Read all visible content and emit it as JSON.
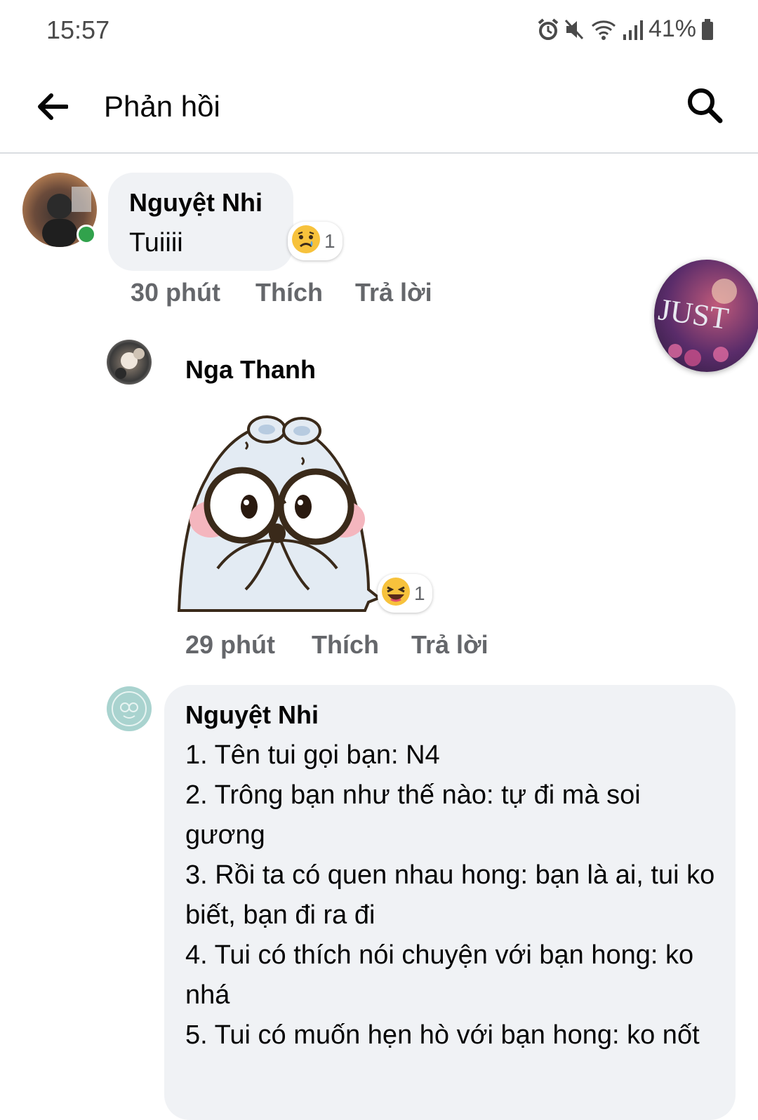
{
  "status_bar": {
    "time": "15:57",
    "battery": "41%"
  },
  "header": {
    "title": "Phản hồi"
  },
  "comments": [
    {
      "author": "Nguyệt Nhi",
      "text": "Tuiiii",
      "reaction_count": "1",
      "time": "30 phút",
      "like_label": "Thích",
      "reply_label": "Trả lời"
    },
    {
      "author": "Nga Thanh",
      "reaction_count": "1",
      "time": "29 phút",
      "like_label": "Thích",
      "reply_label": "Trả lời"
    },
    {
      "author": "Nguyệt Nhi",
      "text": "1. Tên tui gọi bạn: N4\n2. Trông bạn như thế nào: tự đi mà soi gương\n3. Rồi ta có quen nhau hong: bạn là ai, tui ko biết, bạn đi ra đi\n4. Tui có thích nói chuyện với bạn hong: ko nhá\n5. Tui có muốn hẹn hò với bạn hong: ko nốt"
    }
  ],
  "chat_head": {
    "label": "JUST"
  },
  "colors": {
    "bubble": "#f0f2f5",
    "meta": "#65676b",
    "online": "#31a24c",
    "divider": "#dadde1"
  }
}
